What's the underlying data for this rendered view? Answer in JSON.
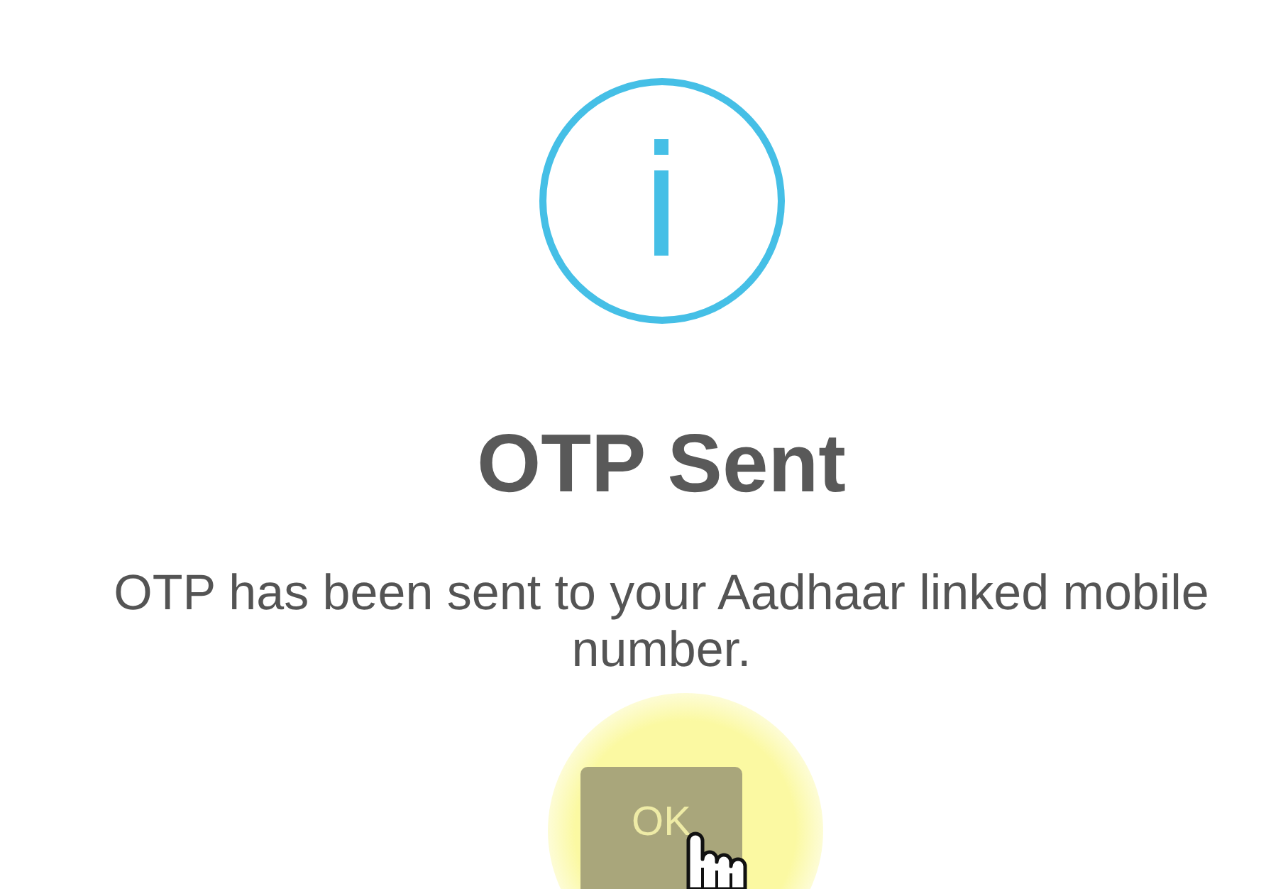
{
  "dialog": {
    "title": "OTP Sent",
    "message": "OTP has been sent to your Aadhaar linked mobile number.",
    "buttons": [
      {
        "label": "OK"
      }
    ]
  }
}
